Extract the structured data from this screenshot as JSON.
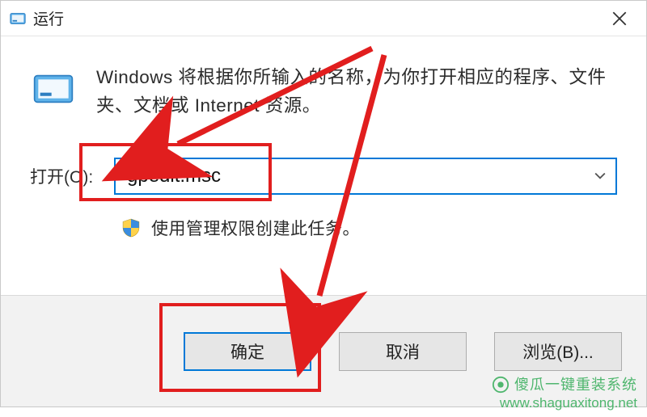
{
  "titlebar": {
    "title": "运行"
  },
  "content": {
    "description": "Windows 将根据你所输入的名称，为你打开相应的程序、文件夹、文档或 Internet 资源。",
    "open_label": "打开(O):",
    "input_value": "gpedit.msc",
    "shield_note": "使用管理权限创建此任务。"
  },
  "buttons": {
    "ok": "确定",
    "cancel": "取消",
    "browse": "浏览(B)..."
  },
  "watermark": {
    "line1": "傻瓜一键重装系统",
    "line2": "www.shaguaxitong.net"
  }
}
